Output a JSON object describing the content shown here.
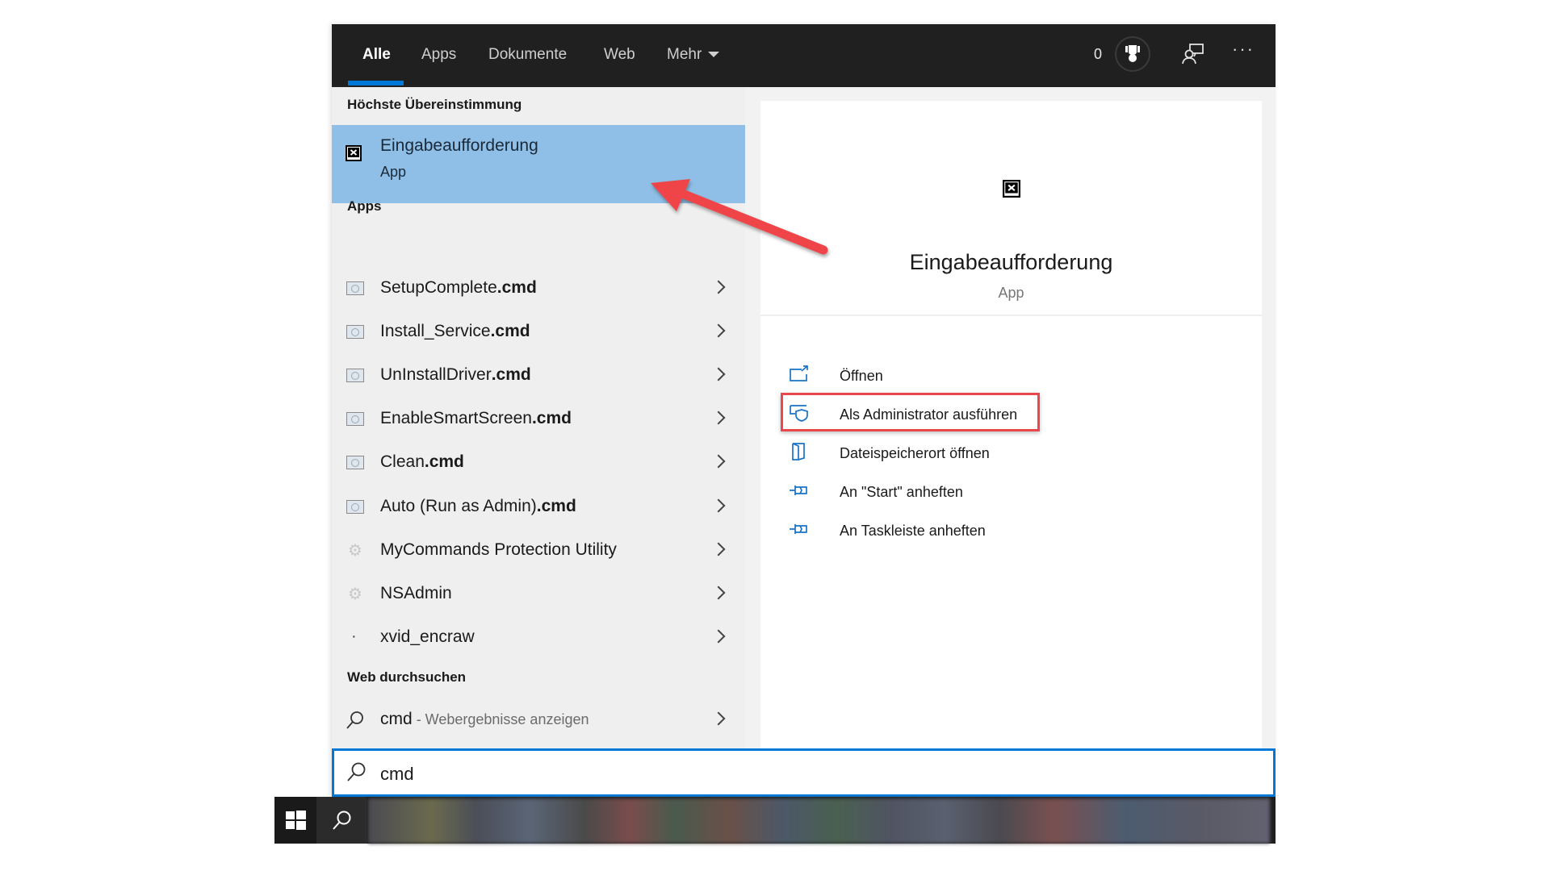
{
  "tabs": [
    {
      "label": "Alle",
      "active": true
    },
    {
      "label": "Apps",
      "active": false
    },
    {
      "label": "Dokumente",
      "active": false
    },
    {
      "label": "Web",
      "active": false
    },
    {
      "label": "Mehr",
      "active": false
    }
  ],
  "header": {
    "points": "0",
    "trophy_icon": "trophy-icon",
    "feedback_icon": "feedback-icon",
    "more_label": "···"
  },
  "best_match": {
    "section_title": "Höchste Übereinstimmung",
    "title": "Eingabeaufforderung",
    "subtitle": "App",
    "icon": "command-prompt-icon"
  },
  "apps": {
    "section_title": "Apps",
    "items": [
      {
        "name": "SetupComplete",
        "ext": ".cmd",
        "icon": "script-icon"
      },
      {
        "name": "Install_Service",
        "ext": ".cmd",
        "icon": "script-icon"
      },
      {
        "name": "UnInstallDriver",
        "ext": ".cmd",
        "icon": "script-icon"
      },
      {
        "name": "EnableSmartScreen",
        "ext": ".cmd",
        "icon": "script-icon"
      },
      {
        "name": "Clean",
        "ext": ".cmd",
        "icon": "script-icon"
      },
      {
        "name": "Auto (Run as Admin)",
        "ext": ".cmd",
        "icon": "script-icon"
      },
      {
        "name": "MyCommands Protection Utility",
        "ext": "",
        "icon": "app-icon"
      },
      {
        "name": "NSAdmin",
        "ext": "",
        "icon": "app-icon"
      },
      {
        "name": "xvid_encraw",
        "ext": "",
        "icon": "dot-icon"
      }
    ]
  },
  "web": {
    "section_title": "Web durchsuchen",
    "query": "cmd",
    "hint": " - Webergebnisse anzeigen"
  },
  "preview": {
    "title": "Eingabeaufforderung",
    "subtitle": "App",
    "actions": [
      {
        "label": "Öffnen",
        "icon": "open-icon"
      },
      {
        "label": "Als Administrator ausführen",
        "icon": "run-as-admin-icon",
        "highlighted": true
      },
      {
        "label": "Dateispeicherort öffnen",
        "icon": "file-location-icon"
      },
      {
        "label": "An \"Start\" anheften",
        "icon": "pin-icon"
      },
      {
        "label": "An Taskleiste anheften",
        "icon": "pin-icon"
      }
    ]
  },
  "search": {
    "value": "cmd",
    "placeholder": ""
  },
  "colors": {
    "accent": "#0078d7",
    "selection": "#8fbfe6",
    "annotation_red": "#e8474c",
    "topbar": "#202020"
  }
}
